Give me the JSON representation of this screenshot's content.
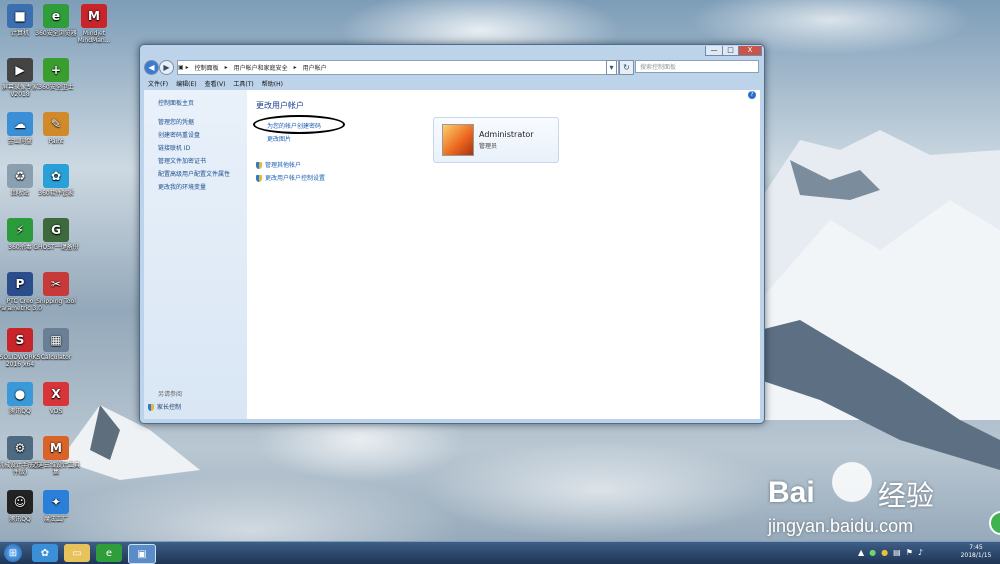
{
  "desktop": {
    "icons": [
      {
        "label": "计算机",
        "glyph": "■",
        "color": "#3b6fb0"
      },
      {
        "label": "360安全浏览器",
        "glyph": "e",
        "color": "#2f9d3a"
      },
      {
        "label": "Mindjet MindMan...",
        "glyph": "M",
        "color": "#c8252b"
      },
      {
        "label": "屏幕录像专家 V2018",
        "glyph": "▶",
        "color": "#444"
      },
      {
        "label": "360安全卫士",
        "glyph": "+",
        "color": "#3a9e2f"
      },
      {
        "label": "金山网盘",
        "glyph": "☁",
        "color": "#3a8fd6"
      },
      {
        "label": "Paint",
        "glyph": "✎",
        "color": "#d08a2a"
      },
      {
        "label": "回收站",
        "glyph": "♻",
        "color": "#8aa0b0"
      },
      {
        "label": "360软件管家",
        "glyph": "✿",
        "color": "#2aa0d8"
      },
      {
        "label": "360杀毒",
        "glyph": "⚡",
        "color": "#2c9b3c"
      },
      {
        "label": "GHOST一键备份",
        "glyph": "G",
        "color": "#3c6a3c"
      },
      {
        "label": "PTC Creo Parametric 3.0",
        "glyph": "P",
        "color": "#2b4d8c"
      },
      {
        "label": "Snipping Tool",
        "glyph": "✂",
        "color": "#c83a3a"
      },
      {
        "label": "SOLIDWORKS 2016 x64",
        "glyph": "S",
        "color": "#c8252b"
      },
      {
        "label": "Calculator",
        "glyph": "▦",
        "color": "#6a7f96"
      },
      {
        "label": "腾讯QQ",
        "glyph": "●",
        "color": "#3a9ad9"
      },
      {
        "label": "VDS",
        "glyph": "X",
        "color": "#d8353a"
      },
      {
        "label": "机械设计手册(软件版)",
        "glyph": "⚙",
        "color": "#4d6a80"
      },
      {
        "label": "迈迪三维设计工具集",
        "glyph": "M",
        "color": "#d8642a"
      },
      {
        "label": "腾讯QQ",
        "glyph": "☺",
        "color": "#222"
      },
      {
        "label": "魔法工厂",
        "glyph": "✦",
        "color": "#2a7fd8"
      }
    ]
  },
  "window": {
    "controls": {
      "minimize": "—",
      "maximize": "□",
      "close": "X"
    },
    "nav": {
      "back": "◀",
      "forward": "▶",
      "refresh": "↻",
      "dropdown": "▾"
    },
    "breadcrumb": [
      "控制面板",
      "用户帐户和家庭安全",
      "用户帐户"
    ],
    "search_placeholder": "搜索控制面板",
    "menu": [
      "文件(F)",
      "编辑(E)",
      "查看(V)",
      "工具(T)",
      "帮助(H)"
    ],
    "sidebar": {
      "items": [
        "控制面板主页",
        "管理您的凭据",
        "创建密码重设盘",
        "链接联机 ID",
        "管理文件加密证书",
        "配置高级用户配置文件属性",
        "更改我的环境变量"
      ],
      "see_also_title": "另请参阅",
      "see_also_item": "家长控制"
    },
    "main": {
      "title": "更改用户帐户",
      "links": [
        "为您的帐户创建密码",
        "更改图片"
      ],
      "shield_links": [
        "管理其他帐户",
        "更改用户帐户控制设置"
      ],
      "account": {
        "name": "Administrator",
        "role": "管理员"
      },
      "help": "?"
    }
  },
  "watermark": {
    "brand": "Bai",
    "brand2": "经验",
    "url": "jingyan.baidu.com"
  },
  "taskbar": {
    "time": "7:45",
    "date": "2018/1/15"
  }
}
